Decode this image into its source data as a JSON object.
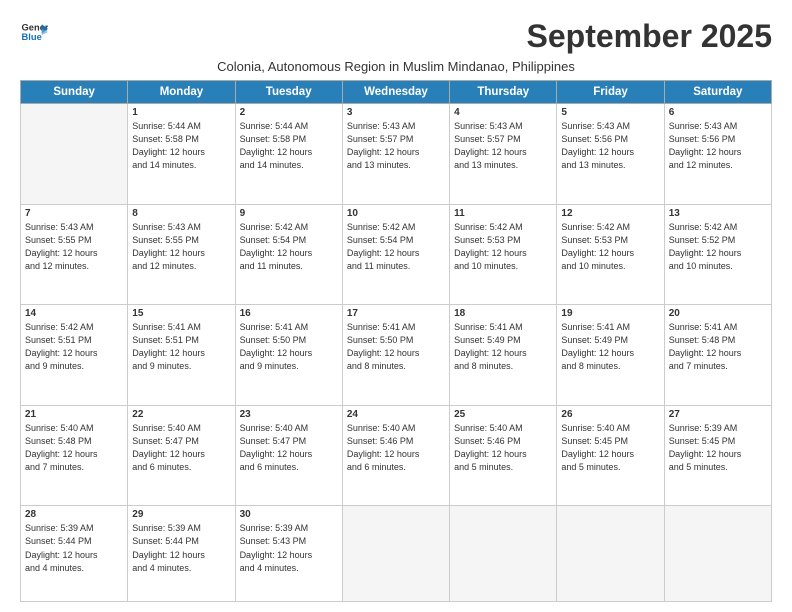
{
  "logo": {
    "line1": "General",
    "line2": "Blue"
  },
  "title": "September 2025",
  "subtitle": "Colonia, Autonomous Region in Muslim Mindanao, Philippines",
  "days_header": [
    "Sunday",
    "Monday",
    "Tuesday",
    "Wednesday",
    "Thursday",
    "Friday",
    "Saturday"
  ],
  "weeks": [
    [
      {
        "num": "",
        "info": ""
      },
      {
        "num": "1",
        "info": "Sunrise: 5:44 AM\nSunset: 5:58 PM\nDaylight: 12 hours\nand 14 minutes."
      },
      {
        "num": "2",
        "info": "Sunrise: 5:44 AM\nSunset: 5:58 PM\nDaylight: 12 hours\nand 14 minutes."
      },
      {
        "num": "3",
        "info": "Sunrise: 5:43 AM\nSunset: 5:57 PM\nDaylight: 12 hours\nand 13 minutes."
      },
      {
        "num": "4",
        "info": "Sunrise: 5:43 AM\nSunset: 5:57 PM\nDaylight: 12 hours\nand 13 minutes."
      },
      {
        "num": "5",
        "info": "Sunrise: 5:43 AM\nSunset: 5:56 PM\nDaylight: 12 hours\nand 13 minutes."
      },
      {
        "num": "6",
        "info": "Sunrise: 5:43 AM\nSunset: 5:56 PM\nDaylight: 12 hours\nand 12 minutes."
      }
    ],
    [
      {
        "num": "7",
        "info": "Sunrise: 5:43 AM\nSunset: 5:55 PM\nDaylight: 12 hours\nand 12 minutes."
      },
      {
        "num": "8",
        "info": "Sunrise: 5:43 AM\nSunset: 5:55 PM\nDaylight: 12 hours\nand 12 minutes."
      },
      {
        "num": "9",
        "info": "Sunrise: 5:42 AM\nSunset: 5:54 PM\nDaylight: 12 hours\nand 11 minutes."
      },
      {
        "num": "10",
        "info": "Sunrise: 5:42 AM\nSunset: 5:54 PM\nDaylight: 12 hours\nand 11 minutes."
      },
      {
        "num": "11",
        "info": "Sunrise: 5:42 AM\nSunset: 5:53 PM\nDaylight: 12 hours\nand 10 minutes."
      },
      {
        "num": "12",
        "info": "Sunrise: 5:42 AM\nSunset: 5:53 PM\nDaylight: 12 hours\nand 10 minutes."
      },
      {
        "num": "13",
        "info": "Sunrise: 5:42 AM\nSunset: 5:52 PM\nDaylight: 12 hours\nand 10 minutes."
      }
    ],
    [
      {
        "num": "14",
        "info": "Sunrise: 5:42 AM\nSunset: 5:51 PM\nDaylight: 12 hours\nand 9 minutes."
      },
      {
        "num": "15",
        "info": "Sunrise: 5:41 AM\nSunset: 5:51 PM\nDaylight: 12 hours\nand 9 minutes."
      },
      {
        "num": "16",
        "info": "Sunrise: 5:41 AM\nSunset: 5:50 PM\nDaylight: 12 hours\nand 9 minutes."
      },
      {
        "num": "17",
        "info": "Sunrise: 5:41 AM\nSunset: 5:50 PM\nDaylight: 12 hours\nand 8 minutes."
      },
      {
        "num": "18",
        "info": "Sunrise: 5:41 AM\nSunset: 5:49 PM\nDaylight: 12 hours\nand 8 minutes."
      },
      {
        "num": "19",
        "info": "Sunrise: 5:41 AM\nSunset: 5:49 PM\nDaylight: 12 hours\nand 8 minutes."
      },
      {
        "num": "20",
        "info": "Sunrise: 5:41 AM\nSunset: 5:48 PM\nDaylight: 12 hours\nand 7 minutes."
      }
    ],
    [
      {
        "num": "21",
        "info": "Sunrise: 5:40 AM\nSunset: 5:48 PM\nDaylight: 12 hours\nand 7 minutes."
      },
      {
        "num": "22",
        "info": "Sunrise: 5:40 AM\nSunset: 5:47 PM\nDaylight: 12 hours\nand 6 minutes."
      },
      {
        "num": "23",
        "info": "Sunrise: 5:40 AM\nSunset: 5:47 PM\nDaylight: 12 hours\nand 6 minutes."
      },
      {
        "num": "24",
        "info": "Sunrise: 5:40 AM\nSunset: 5:46 PM\nDaylight: 12 hours\nand 6 minutes."
      },
      {
        "num": "25",
        "info": "Sunrise: 5:40 AM\nSunset: 5:46 PM\nDaylight: 12 hours\nand 5 minutes."
      },
      {
        "num": "26",
        "info": "Sunrise: 5:40 AM\nSunset: 5:45 PM\nDaylight: 12 hours\nand 5 minutes."
      },
      {
        "num": "27",
        "info": "Sunrise: 5:39 AM\nSunset: 5:45 PM\nDaylight: 12 hours\nand 5 minutes."
      }
    ],
    [
      {
        "num": "28",
        "info": "Sunrise: 5:39 AM\nSunset: 5:44 PM\nDaylight: 12 hours\nand 4 minutes."
      },
      {
        "num": "29",
        "info": "Sunrise: 5:39 AM\nSunset: 5:44 PM\nDaylight: 12 hours\nand 4 minutes."
      },
      {
        "num": "30",
        "info": "Sunrise: 5:39 AM\nSunset: 5:43 PM\nDaylight: 12 hours\nand 4 minutes."
      },
      {
        "num": "",
        "info": ""
      },
      {
        "num": "",
        "info": ""
      },
      {
        "num": "",
        "info": ""
      },
      {
        "num": "",
        "info": ""
      }
    ]
  ]
}
